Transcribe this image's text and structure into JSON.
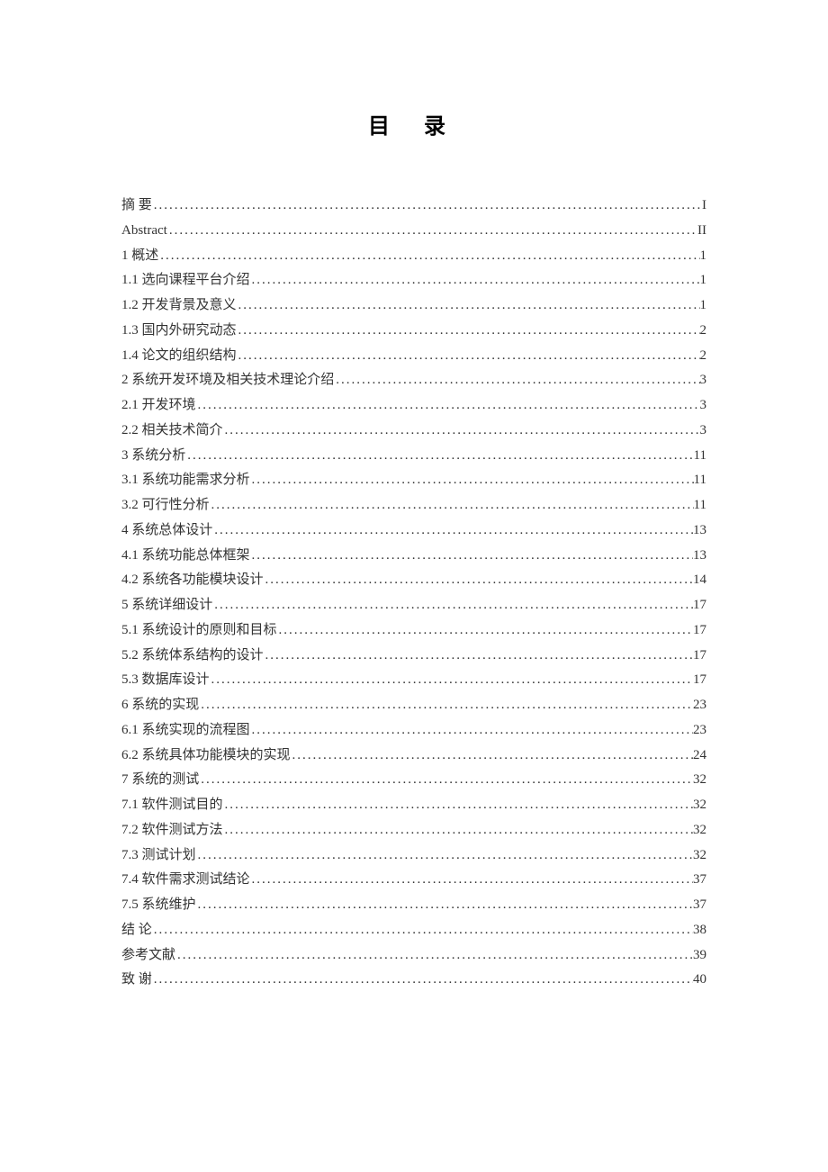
{
  "title": "目 录",
  "entries": [
    {
      "label": "摘   要",
      "page": "I"
    },
    {
      "label": "Abstract",
      "page": "II"
    },
    {
      "label": "1  概述",
      "page": "1"
    },
    {
      "label": "1.1  选向课程平台介绍",
      "page": "1"
    },
    {
      "label": "1.2 开发背景及意义",
      "page": "1"
    },
    {
      "label": "1.3  国内外研究动态",
      "page": "2"
    },
    {
      "label": "1.4  论文的组织结构",
      "page": "2"
    },
    {
      "label": "2 系统开发环境及相关技术理论介绍",
      "page": "3"
    },
    {
      "label": "2.1 开发环境",
      "page": "3"
    },
    {
      "label": "2.2  相关技术简介",
      "page": "3"
    },
    {
      "label": "3  系统分析",
      "page": "11"
    },
    {
      "label": "3.1 系统功能需求分析",
      "page": "11"
    },
    {
      "label": "3.2  可行性分析",
      "page": "11"
    },
    {
      "label": "4  系统总体设计",
      "page": "13"
    },
    {
      "label": "4.1  系统功能总体框架",
      "page": "13"
    },
    {
      "label": "4.2  系统各功能模块设计",
      "page": "14"
    },
    {
      "label": "5  系统详细设计",
      "page": "17"
    },
    {
      "label": "5.1 系统设计的原则和目标",
      "page": "17"
    },
    {
      "label": "5.2  系统体系结构的设计",
      "page": "17"
    },
    {
      "label": "5.3  数据库设计",
      "page": "17"
    },
    {
      "label": "6  系统的实现",
      "page": "23"
    },
    {
      "label": "6.1  系统实现的流程图",
      "page": "23"
    },
    {
      "label": "6.2  系统具体功能模块的实现",
      "page": "24"
    },
    {
      "label": "7  系统的测试",
      "page": "32"
    },
    {
      "label": "7.1 软件测试目的",
      "page": "32"
    },
    {
      "label": "7.2 软件测试方法",
      "page": "32"
    },
    {
      "label": "7.3 测试计划",
      "page": "32"
    },
    {
      "label": "7.4 软件需求测试结论",
      "page": "37"
    },
    {
      "label": "7.5 系统维护",
      "page": "37"
    },
    {
      "label": "结   论",
      "page": "38"
    },
    {
      "label": "参考文献",
      "page": "39"
    },
    {
      "label": "致      谢",
      "page": "40"
    }
  ]
}
